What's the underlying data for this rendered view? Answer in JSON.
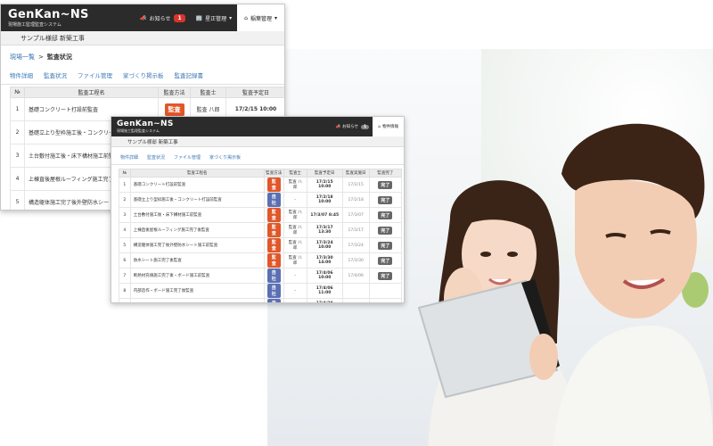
{
  "app": {
    "logo": "GenKan~NS",
    "logo_sub": "現場施工監理監査システム"
  },
  "topbar": {
    "notice_label": "お知らせ",
    "notice_count": "1",
    "company_label": "星正管理",
    "admin_label": "稲葉管理",
    "admin_label_small": "物件情報"
  },
  "project_title": "サンプル様邸 新築工事",
  "breadcrumb": {
    "home": "現場一覧",
    "sep": ">",
    "current": "監査状況"
  },
  "tabs": [
    "物件詳細",
    "監査状況",
    "ファイル管理",
    "家づくり掲示板",
    "監査記録書"
  ],
  "tabs_small": [
    "物件詳細",
    "監査状況",
    "ファイル管理",
    "家づくり掲示板"
  ],
  "back_table": {
    "headers": [
      "№",
      "監査工程名",
      "監査方法",
      "監査士",
      "監査予定日"
    ],
    "rows": [
      {
        "no": "1",
        "name": "基礎コンクリート打設前監査",
        "method": "監査",
        "inspector": "監査 八郎",
        "date": "17/2/15 10:00"
      },
      {
        "no": "2",
        "name": "基礎立上り型枠施工後・コンクリート打設前監査",
        "method": "",
        "inspector": "",
        "date": ""
      },
      {
        "no": "3",
        "name": "土台敷付施工後・床下構材施工前監査",
        "method": "",
        "inspector": "",
        "date": ""
      },
      {
        "no": "4",
        "name": "上棟直後屋根ルーフィング施工完了後監査",
        "method": "",
        "inspector": "",
        "date": ""
      },
      {
        "no": "5",
        "name": "構造躯体施工完了後外壁防水シート施工前監査",
        "method": "",
        "inspector": "",
        "date": ""
      }
    ]
  },
  "front_table": {
    "headers": [
      "№",
      "監査工程名",
      "監査方法",
      "監査士",
      "監査予定日",
      "監査実施日",
      "監査完了"
    ],
    "rows": [
      {
        "no": "1",
        "name": "基礎コンクリート打設前監査",
        "method": "監査",
        "mcolor": "red",
        "inspector": "監査 八郎",
        "plan": "17/2/15 10:00",
        "done_date": "17/2/15",
        "status": "完了"
      },
      {
        "no": "2",
        "name": "基礎立上り型枠施工後・コンクリート打設前監査",
        "method": "自社",
        "mcolor": "blue",
        "inspector": "-",
        "plan": "17/2/18 10:00",
        "done_date": "17/2/18",
        "status": "完了"
      },
      {
        "no": "3",
        "name": "土台敷付施工後・床下構材施工前監査",
        "method": "監査",
        "mcolor": "red",
        "inspector": "監査 八郎",
        "plan": "17/3/07 8:45",
        "done_date": "17/3/07",
        "status": "完了"
      },
      {
        "no": "4",
        "name": "上棟直後屋根ルーフィング施工完了後監査",
        "method": "監査",
        "mcolor": "red",
        "inspector": "監査 八郎",
        "plan": "17/3/17 13:30",
        "done_date": "17/3/17",
        "status": "完了"
      },
      {
        "no": "5",
        "name": "構造躯体施工完了後外壁防水シート施工前監査",
        "method": "監査",
        "mcolor": "red",
        "inspector": "監査 八郎",
        "plan": "17/3/24 10:00",
        "done_date": "17/3/24",
        "status": "完了"
      },
      {
        "no": "6",
        "name": "防水シート施工完了後監査",
        "method": "監査",
        "mcolor": "red",
        "inspector": "監査 八郎",
        "plan": "17/3/30 14:00",
        "done_date": "17/3/30",
        "status": "完了"
      },
      {
        "no": "7",
        "name": "断熱材充填施工完了後・ボード施工前監査",
        "method": "自社",
        "mcolor": "blue",
        "inspector": "-",
        "plan": "17/4/06 10:00",
        "done_date": "17/4/06",
        "status": "完了"
      },
      {
        "no": "8",
        "name": "内部造作・ボード施工完了後監査",
        "method": "自社",
        "mcolor": "blue",
        "inspector": "-",
        "plan": "17/4/06 11:00",
        "done_date": "",
        "status": ""
      },
      {
        "no": "9",
        "name": "外装施工完了後・設備設置配管工事監査",
        "method": "自社",
        "mcolor": "blue",
        "inspector": "-",
        "plan": "17/4/20 13:20",
        "done_date": "",
        "status": ""
      },
      {
        "no": "10",
        "name": "建物工事・完成完了後監査",
        "method": "自社",
        "mcolor": "blue",
        "inspector": "",
        "plan": "17/5/00",
        "done_date": "",
        "status": ""
      }
    ]
  }
}
